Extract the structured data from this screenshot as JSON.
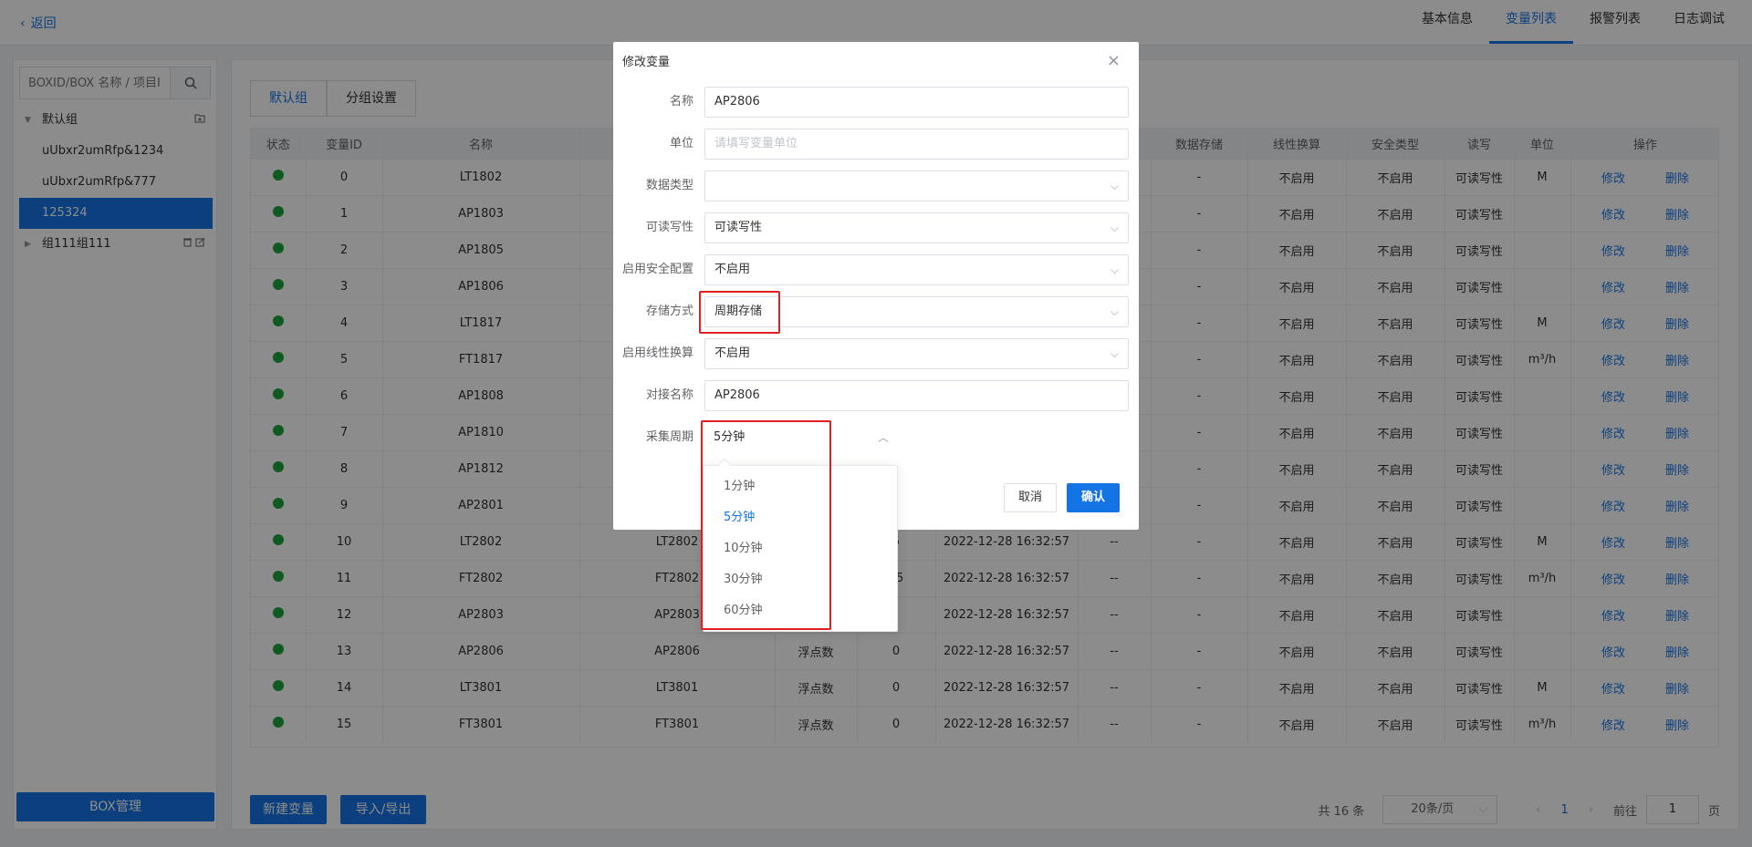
{
  "topbar": {
    "back_label": "返回",
    "tabs": [
      "基本信息",
      "变量列表",
      "报警列表",
      "日志调试"
    ],
    "active_tab": "变量列表"
  },
  "sidebar": {
    "search_placeholder": "BOXID/BOX 名称 / 项目ID",
    "tree": [
      {
        "label": "默认组",
        "level": 0,
        "expanded": true
      },
      {
        "label": "uUbxr2umRfp&1234",
        "level": 1
      },
      {
        "label": "uUbxr2umRfp&777",
        "level": 1
      },
      {
        "label": "125324",
        "level": 1,
        "selected": true
      },
      {
        "label": "组111组111",
        "level": 0,
        "expanded": false
      }
    ],
    "box_button": "BOX管理"
  },
  "main": {
    "tabs": [
      "默认组",
      "分组设置"
    ],
    "active_tab": "默认组",
    "table": {
      "headers": [
        "状态",
        "变量ID",
        "名称",
        "",
        "",
        "",
        "",
        "",
        "数据存储",
        "线性换算",
        "安全类型",
        "读写",
        "单位",
        "操作"
      ],
      "rows": [
        {
          "id": "0",
          "name": "LT1802",
          "c3": "",
          "c4": "",
          "c5": "",
          "c6": "",
          "c7": "",
          "storage": "-",
          "linear": "不启用",
          "safety": "不启用",
          "rw": "可读写性",
          "unit": "M"
        },
        {
          "id": "1",
          "name": "AP1803",
          "c3": "",
          "c4": "",
          "c5": "",
          "c6": "",
          "c7": "",
          "storage": "-",
          "linear": "不启用",
          "safety": "不启用",
          "rw": "可读写性",
          "unit": ""
        },
        {
          "id": "2",
          "name": "AP1805",
          "c3": "",
          "c4": "",
          "c5": "",
          "c6": "",
          "c7": "",
          "storage": "-",
          "linear": "不启用",
          "safety": "不启用",
          "rw": "可读写性",
          "unit": ""
        },
        {
          "id": "3",
          "name": "AP1806",
          "c3": "",
          "c4": "",
          "c5": "",
          "c6": "",
          "c7": "",
          "storage": "-",
          "linear": "不启用",
          "safety": "不启用",
          "rw": "可读写性",
          "unit": ""
        },
        {
          "id": "4",
          "name": "LT1817",
          "c3": "",
          "c4": "",
          "c5": "",
          "c6": "",
          "c7": "",
          "storage": "-",
          "linear": "不启用",
          "safety": "不启用",
          "rw": "可读写性",
          "unit": "M"
        },
        {
          "id": "5",
          "name": "FT1817",
          "c3": "",
          "c4": "",
          "c5": "",
          "c6": "",
          "c7": "",
          "storage": "-",
          "linear": "不启用",
          "safety": "不启用",
          "rw": "可读写性",
          "unit": "m³/h"
        },
        {
          "id": "6",
          "name": "AP1808",
          "c3": "",
          "c4": "",
          "c5": "",
          "c6": "",
          "c7": "",
          "storage": "-",
          "linear": "不启用",
          "safety": "不启用",
          "rw": "可读写性",
          "unit": ""
        },
        {
          "id": "7",
          "name": "AP1810",
          "c3": "",
          "c4": "",
          "c5": "",
          "c6": "",
          "c7": "",
          "storage": "-",
          "linear": "不启用",
          "safety": "不启用",
          "rw": "可读写性",
          "unit": ""
        },
        {
          "id": "8",
          "name": "AP1812",
          "c3": "",
          "c4": "",
          "c5": "",
          "c6": "",
          "c7": "",
          "storage": "-",
          "linear": "不启用",
          "safety": "不启用",
          "rw": "可读写性",
          "unit": ""
        },
        {
          "id": "9",
          "name": "AP2801",
          "c3": "",
          "c4": "",
          "c5": "",
          "c6": "",
          "c7": "",
          "storage": "-",
          "linear": "不启用",
          "safety": "不启用",
          "rw": "可读写性",
          "unit": ""
        },
        {
          "id": "10",
          "name": "LT2802",
          "c3": "LT2802",
          "c4": "",
          "c5": "5",
          "c6": "2022-12-28 16:32:57",
          "c7": "--",
          "storage": "-",
          "linear": "不启用",
          "safety": "不启用",
          "rw": "可读写性",
          "unit": "M"
        },
        {
          "id": "11",
          "name": "FT2802",
          "c3": "FT2802",
          "c4": "",
          "c5": "55",
          "c6": "2022-12-28 16:32:57",
          "c7": "--",
          "storage": "-",
          "linear": "不启用",
          "safety": "不启用",
          "rw": "可读写性",
          "unit": "m³/h"
        },
        {
          "id": "12",
          "name": "AP2803",
          "c3": "AP2803",
          "c4": "",
          "c5": "",
          "c6": "2022-12-28 16:32:57",
          "c7": "--",
          "storage": "-",
          "linear": "不启用",
          "safety": "不启用",
          "rw": "可读写性",
          "unit": ""
        },
        {
          "id": "13",
          "name": "AP2806",
          "c3": "AP2806",
          "c4": "浮点数",
          "c5": "0",
          "c6": "2022-12-28 16:32:57",
          "c7": "--",
          "storage": "-",
          "linear": "不启用",
          "safety": "不启用",
          "rw": "可读写性",
          "unit": ""
        },
        {
          "id": "14",
          "name": "LT3801",
          "c3": "LT3801",
          "c4": "浮点数",
          "c5": "0",
          "c6": "2022-12-28 16:32:57",
          "c7": "--",
          "storage": "-",
          "linear": "不启用",
          "safety": "不启用",
          "rw": "可读写性",
          "unit": "M"
        },
        {
          "id": "15",
          "name": "FT3801",
          "c3": "FT3801",
          "c4": "浮点数",
          "c5": "0",
          "c6": "2022-12-28 16:32:57",
          "c7": "--",
          "storage": "-",
          "linear": "不启用",
          "safety": "不启用",
          "rw": "可读写性",
          "unit": "m³/h"
        }
      ],
      "action_edit": "修改",
      "action_delete": "删除",
      "status_color": "#1ea33d"
    },
    "new_var_button": "新建变量",
    "import_export_button": "导入/导出",
    "pager": {
      "total": "共 16 条",
      "page_size": "20条/页",
      "current_page": "1",
      "goto_label": "前往",
      "goto_value": "1",
      "page_suffix": "页"
    }
  },
  "dialog": {
    "title": "修改变量",
    "fields": [
      {
        "label": "名称",
        "value": "AP2806",
        "placeholder": "",
        "type": "input"
      },
      {
        "label": "单位",
        "value": "",
        "placeholder": "请填写变量单位",
        "type": "input"
      },
      {
        "label": "数据类型",
        "value": "",
        "placeholder": "",
        "type": "select"
      },
      {
        "label": "可读写性",
        "value": "可读写性",
        "placeholder": "",
        "type": "select"
      },
      {
        "label": "启用安全配置",
        "value": "不启用",
        "placeholder": "",
        "type": "select"
      },
      {
        "label": "存储方式",
        "value": "周期存储",
        "placeholder": "",
        "type": "select"
      },
      {
        "label": "启用线性换算",
        "value": "不启用",
        "placeholder": "",
        "type": "select"
      },
      {
        "label": "对接名称",
        "value": "AP2806",
        "placeholder": "",
        "type": "input"
      },
      {
        "label": "采集周期",
        "value": "5分钟",
        "placeholder": "",
        "type": "select-open"
      }
    ],
    "cancel_label": "取消",
    "confirm_label": "确认",
    "dropdown_options": [
      "1分钟",
      "5分钟",
      "10分钟",
      "30分钟",
      "60分钟"
    ],
    "dropdown_selected": "5分钟"
  },
  "colors": {
    "primary": "#1474e4",
    "highlight": "#e02020",
    "status_ok": "#1ea33d"
  }
}
